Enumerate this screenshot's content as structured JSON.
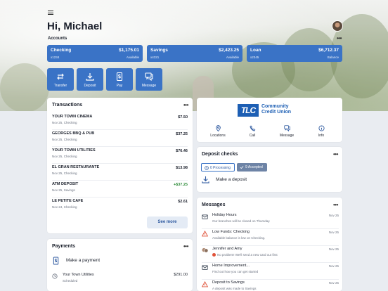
{
  "header": {
    "greeting": "Hi, Michael",
    "accounts_label": "Accounts"
  },
  "accounts": [
    {
      "name": "Checking",
      "number": "x1234",
      "balance": "$1,175.01",
      "kind": "Available"
    },
    {
      "name": "Savings",
      "number": "x4321",
      "balance": "$2,423.25",
      "kind": "Available"
    },
    {
      "name": "Loan",
      "number": "x2345",
      "balance": "$6,712.37",
      "kind": "Balance"
    }
  ],
  "quick_actions": [
    {
      "label": "Transfer",
      "icon": "transfer-arrows-icon"
    },
    {
      "label": "Deposit",
      "icon": "deposit-tray-icon"
    },
    {
      "label": "Pay",
      "icon": "pay-dollar-icon"
    },
    {
      "label": "Message",
      "icon": "message-chat-icon"
    }
  ],
  "transactions": {
    "title": "Transactions",
    "items": [
      {
        "name": "YOUR TOWN CINEMA",
        "sub": "Nov 25, Checking",
        "amount": "$7.50"
      },
      {
        "name": "GEORGES BBQ & PUB",
        "sub": "Nov 25, Checking",
        "amount": "$37.25"
      },
      {
        "name": "YOUR TOWN UTILITIES",
        "sub": "Nov 25, Checking",
        "amount": "$76.46"
      },
      {
        "name": "EL GRAN RESTAURANTE",
        "sub": "Nov 25, Checking",
        "amount": "$13.98"
      },
      {
        "name": "ATM DEPOSIT",
        "sub": "Nov 25, Savings",
        "amount": "+$37.25"
      },
      {
        "name": "LE PETITE CAFE",
        "sub": "Nov 24, Checking",
        "amount": "$2.61"
      }
    ],
    "see_more": "See more"
  },
  "payments": {
    "title": "Payments",
    "make_payment": "Make a payment",
    "items": [
      {
        "name": "Your Town Utilities",
        "sub": "Scheduled",
        "amount": "$291.00"
      }
    ]
  },
  "credit_union": {
    "logo_mark": "TLC",
    "logo_line1": "Community",
    "logo_line2": "Credit Union",
    "links": [
      {
        "label": "Locations",
        "icon": "location-pin-icon"
      },
      {
        "label": "Call",
        "icon": "phone-icon"
      },
      {
        "label": "Message",
        "icon": "message-chat-icon"
      },
      {
        "label": "Info",
        "icon": "info-icon"
      }
    ]
  },
  "deposit_checks": {
    "title": "Deposit checks",
    "processing": "0 Processing",
    "accepted": "9 Accepted",
    "make_deposit": "Make a deposit"
  },
  "messages": {
    "title": "Messages",
    "items": [
      {
        "title": "Holiday Hours",
        "preview": "Our branches will be closed on Thursday.",
        "date": "Nov 25",
        "icon": "envelope-icon"
      },
      {
        "title": "Low Funds: Checking",
        "preview": "Available balance is low on Checking.",
        "date": "Nov 25",
        "icon": "warning-icon"
      },
      {
        "title": "Jennifer and Amy",
        "preview": "No problem! We'll send a new card out first",
        "date": "Nov 25",
        "icon": "contacts-avatar-icon"
      },
      {
        "title": "Home Improvement...",
        "preview": "Find out how you can get started",
        "date": "Nov 25",
        "icon": "envelope-icon"
      },
      {
        "title": "Deposit to Savings",
        "preview": "A deposit was made to Savings",
        "date": "Nov 25",
        "icon": "warning-icon"
      }
    ]
  },
  "colors": {
    "accent": "#3a73c6",
    "positive": "#2e8b3a",
    "warning": "#e0533a"
  }
}
